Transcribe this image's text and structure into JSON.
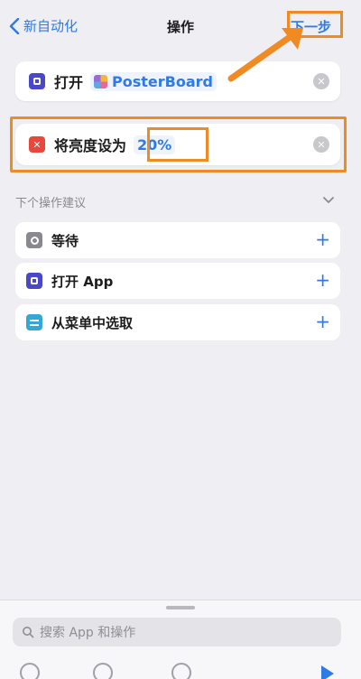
{
  "nav": {
    "back_label": "新自动化",
    "title": "操作",
    "next_label": "下一步"
  },
  "actions": [
    {
      "label": "打开",
      "token": "PosterBoard",
      "icon": "open-app-icon"
    },
    {
      "label": "将亮度设为",
      "token": "20%",
      "icon": "brightness-icon"
    }
  ],
  "suggestions": {
    "title": "下个操作建议",
    "items": [
      {
        "label": "等待",
        "icon": "wait-icon"
      },
      {
        "label": "打开 App",
        "icon": "open-app-icon"
      },
      {
        "label": "从菜单中选取",
        "icon": "menu-icon"
      }
    ]
  },
  "search": {
    "placeholder": "搜索 App 和操作"
  },
  "colors": {
    "accent": "#2f7ae5",
    "annotation": "#f08a22",
    "background": "#eeeef3"
  }
}
